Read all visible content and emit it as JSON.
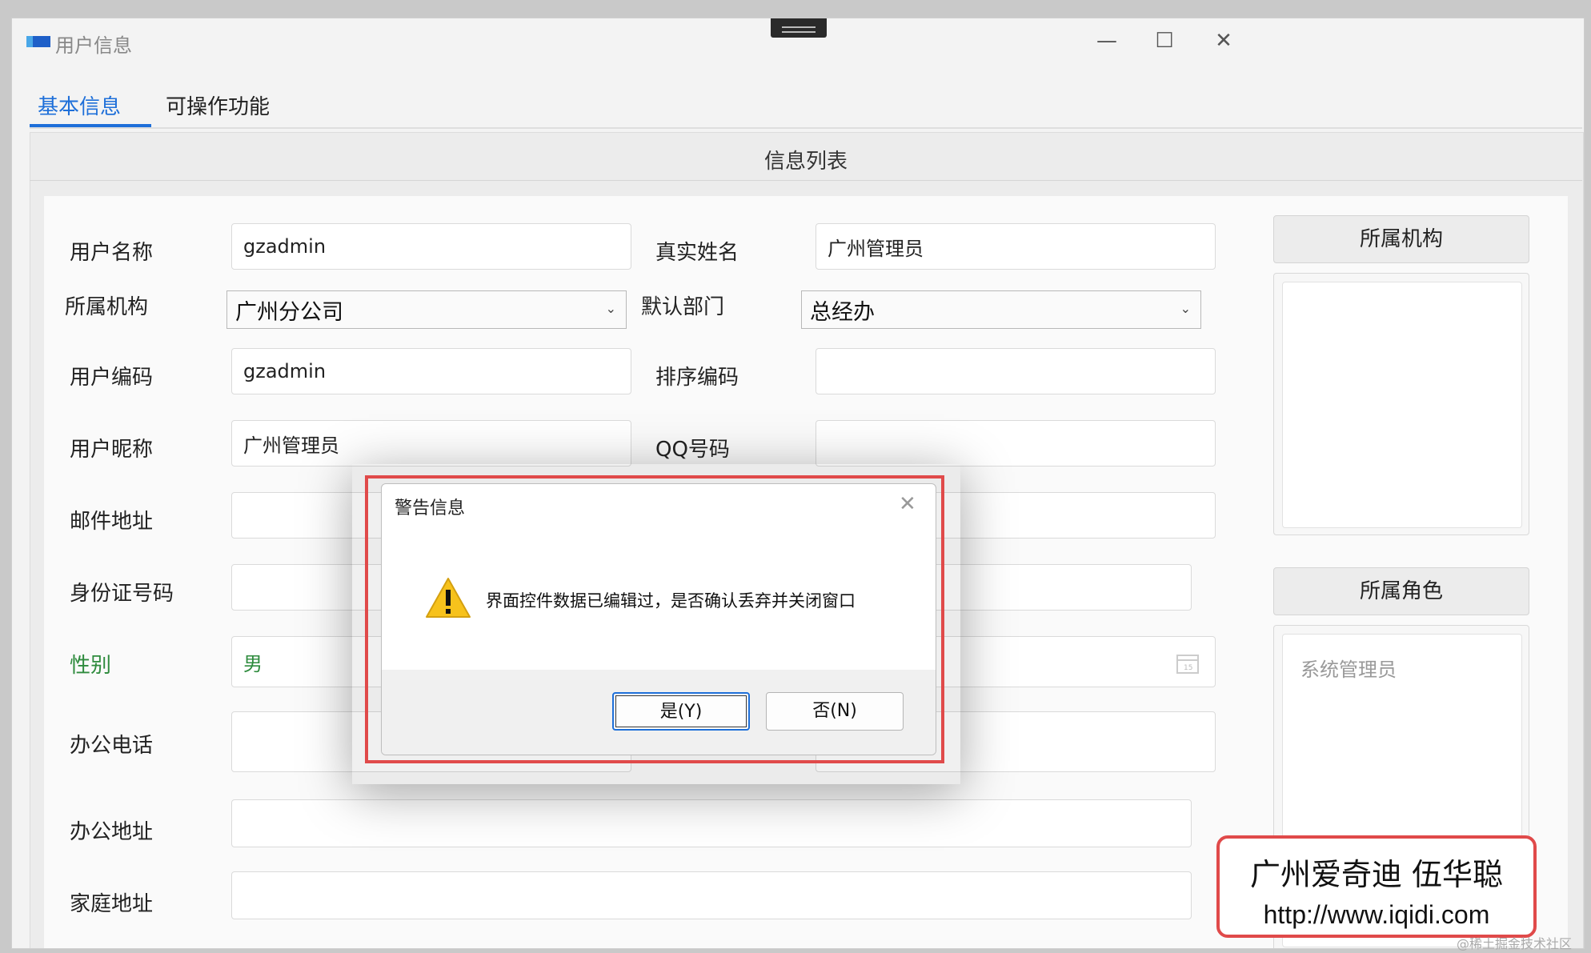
{
  "window": {
    "title": "用户信息",
    "controls": {
      "minimize": "—",
      "maximize": "☐",
      "close": "✕"
    }
  },
  "tabs": [
    {
      "label": "基本信息",
      "active": true
    },
    {
      "label": "可操作功能",
      "active": false
    }
  ],
  "panel": {
    "title": "信息列表"
  },
  "form": {
    "username": {
      "label": "用户名称",
      "value": "gzadmin"
    },
    "realname": {
      "label": "真实姓名",
      "value": "广州管理员"
    },
    "org": {
      "label": "所属机构",
      "value": "广州分公司"
    },
    "dept": {
      "label": "默认部门",
      "value": "总经办"
    },
    "usercode": {
      "label": "用户编码",
      "value": "gzadmin"
    },
    "sortcode": {
      "label": "排序编码",
      "value": ""
    },
    "nickname": {
      "label": "用户昵称",
      "value": "广州管理员"
    },
    "qq": {
      "label": "QQ号码",
      "value": ""
    },
    "email": {
      "label": "邮件地址",
      "value": ""
    },
    "idcard": {
      "label": "身份证号码",
      "value": ""
    },
    "gender": {
      "label": "性别",
      "value": "男"
    },
    "office_phone": {
      "label": "办公电话",
      "value": ""
    },
    "office_addr": {
      "label": "办公地址",
      "value": ""
    },
    "home_addr": {
      "label": "家庭地址",
      "value": ""
    }
  },
  "side": {
    "org_button": "所属机构",
    "role_button": "所属角色",
    "roles": [
      "系统管理员"
    ]
  },
  "dialog": {
    "title": "警告信息",
    "message": "界面控件数据已编辑过，是否确认丢弃并关闭窗口",
    "yes": "是(Y)",
    "no": "否(N)",
    "close": "✕"
  },
  "watermark": {
    "line1": "广州爱奇迪 伍华聪",
    "line2": "http://www.iqidi.com",
    "corner": "@稀土掘金技术社区"
  },
  "colors": {
    "accent": "#1e6fd9",
    "highlight": "#e04a4a",
    "gender_green": "#2e8b3d"
  }
}
